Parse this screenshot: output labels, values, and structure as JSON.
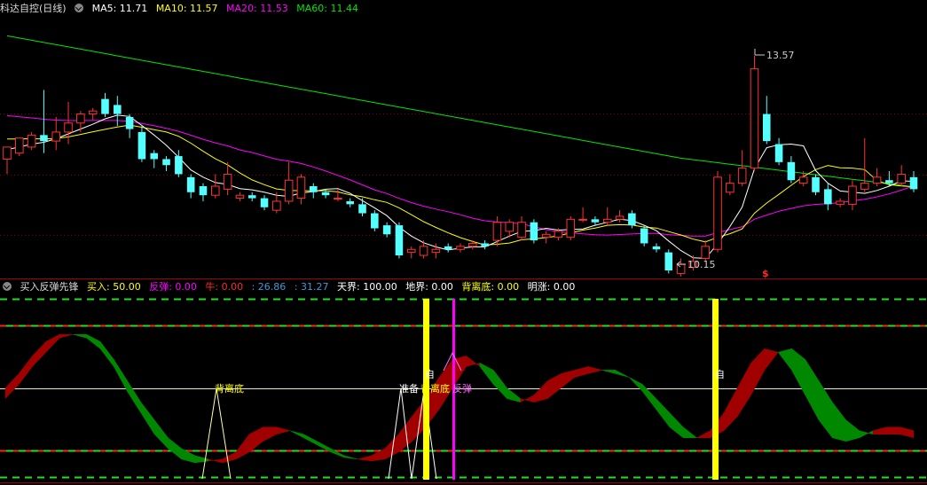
{
  "colors": {
    "up": "#ff3232",
    "down": "#54ffff",
    "ma5": "#ffffff",
    "ma10": "#ffff00",
    "ma20": "#ff00ff",
    "ma60": "#00e600",
    "bull": "#a00000",
    "bear": "#008800",
    "grid": "#800000"
  },
  "top_panel": {
    "title": "科达自控(日线)",
    "ma5": {
      "label": "MA5: 11.71"
    },
    "ma10": {
      "label": "MA10: 11.57"
    },
    "ma20": {
      "label": "MA20: 11.53"
    },
    "ma60": {
      "label": "MA60: 11.44"
    },
    "high_label": "13.57",
    "low_label": "10.15",
    "marker": "$"
  },
  "bottom_panel": {
    "title": "买入反弹先锋",
    "buy": "买入: 50.00",
    "rebound": "反弹: 0.00",
    "bull": "牛: 0.00",
    "v1": ": 26.86",
    "v2": ": 31.27",
    "sky": "天界: 100.00",
    "ground": "地界: 0.00",
    "diverge": "背离底: 0.00",
    "rise": "明涨: 0.00",
    "ann_diverge_1": "背离底",
    "ann_prep": "准备",
    "ann_diverge_2": "背离底",
    "ann_rebound": "反弹",
    "ann_self_1": "自",
    "ann_self_2": "自"
  },
  "chart_data": [
    {
      "type": "candlestick",
      "title": "科达自控(日线)",
      "ylim": [
        10.0,
        14.2
      ],
      "series": [
        {
          "name": "MA5",
          "values": []
        },
        {
          "name": "MA10",
          "values": []
        },
        {
          "name": "MA20",
          "values": []
        },
        {
          "name": "MA60",
          "values": []
        }
      ],
      "candles": [
        [
          11.85,
          12.05,
          11.95,
          11.6
        ],
        [
          11.95,
          12.2,
          12.2,
          11.9
        ],
        [
          12.05,
          12.25,
          12.3,
          12.0
        ],
        [
          12.25,
          12.15,
          13.0,
          11.95
        ],
        [
          12.15,
          12.3,
          12.55,
          12.0
        ],
        [
          12.3,
          12.45,
          12.8,
          12.1
        ],
        [
          12.45,
          12.6,
          12.65,
          12.3
        ],
        [
          12.6,
          12.65,
          12.7,
          12.5
        ],
        [
          12.85,
          12.6,
          12.95,
          12.55
        ],
        [
          12.75,
          12.6,
          12.9,
          12.4
        ],
        [
          12.55,
          12.35,
          12.6,
          12.2
        ],
        [
          12.3,
          11.85,
          12.4,
          11.8
        ],
        [
          11.95,
          11.85,
          12.0,
          11.7
        ],
        [
          11.85,
          11.75,
          11.9,
          11.65
        ],
        [
          11.9,
          11.6,
          12.0,
          11.55
        ],
        [
          11.55,
          11.3,
          11.6,
          11.2
        ],
        [
          11.4,
          11.25,
          11.45,
          11.15
        ],
        [
          11.25,
          11.4,
          11.6,
          11.2
        ],
        [
          11.35,
          11.6,
          11.8,
          11.25
        ],
        [
          11.2,
          11.25,
          11.3,
          11.15
        ],
        [
          11.25,
          11.2,
          11.3,
          11.15
        ],
        [
          11.2,
          11.05,
          11.25,
          11.0
        ],
        [
          11.0,
          11.15,
          11.3,
          10.95
        ],
        [
          11.15,
          11.5,
          11.8,
          11.1
        ],
        [
          11.2,
          11.55,
          11.6,
          11.1
        ],
        [
          11.4,
          11.3,
          11.45,
          11.2
        ],
        [
          11.3,
          11.25,
          11.35,
          11.2
        ],
        [
          11.2,
          11.2,
          11.35,
          11.15
        ],
        [
          11.15,
          11.1,
          11.2,
          11.05
        ],
        [
          11.1,
          10.95,
          11.2,
          10.9
        ],
        [
          10.95,
          10.7,
          11.0,
          10.65
        ],
        [
          10.75,
          10.6,
          10.8,
          10.55
        ],
        [
          10.75,
          10.25,
          10.8,
          10.2
        ],
        [
          10.3,
          10.35,
          10.4,
          10.2
        ],
        [
          10.25,
          10.4,
          10.5,
          10.2
        ],
        [
          10.3,
          10.35,
          10.45,
          10.2
        ],
        [
          10.4,
          10.35,
          10.45,
          10.3
        ],
        [
          10.35,
          10.4,
          10.45,
          10.3
        ],
        [
          10.4,
          10.45,
          10.5,
          10.35
        ],
        [
          10.45,
          10.4,
          10.5,
          10.35
        ],
        [
          10.5,
          10.8,
          10.9,
          10.4
        ],
        [
          10.65,
          10.8,
          10.85,
          10.55
        ],
        [
          10.55,
          10.8,
          10.9,
          10.5
        ],
        [
          10.8,
          10.5,
          10.85,
          10.45
        ],
        [
          10.55,
          10.6,
          10.65,
          10.45
        ],
        [
          10.55,
          10.65,
          10.7,
          10.5
        ],
        [
          10.55,
          10.85,
          10.9,
          10.5
        ],
        [
          10.85,
          10.85,
          11.05,
          10.8
        ],
        [
          10.85,
          10.8,
          10.9,
          10.75
        ],
        [
          10.8,
          10.85,
          11.05,
          10.75
        ],
        [
          10.85,
          10.9,
          11.0,
          10.8
        ],
        [
          10.95,
          10.75,
          11.0,
          10.7
        ],
        [
          10.7,
          10.45,
          10.75,
          10.4
        ],
        [
          10.4,
          10.35,
          10.45,
          10.3
        ],
        [
          10.3,
          10.0,
          10.35,
          9.95
        ],
        [
          9.95,
          10.1,
          10.2,
          9.9
        ],
        [
          10.05,
          10.15,
          10.25,
          10.0
        ],
        [
          10.2,
          10.4,
          10.5,
          10.15
        ],
        [
          10.35,
          11.55,
          11.65,
          10.3
        ],
        [
          11.3,
          11.45,
          11.6,
          11.25
        ],
        [
          11.45,
          11.7,
          12.0,
          11.4
        ],
        [
          11.7,
          13.35,
          13.57,
          11.65
        ],
        [
          12.6,
          12.15,
          12.9,
          12.1
        ],
        [
          12.1,
          11.8,
          12.2,
          11.75
        ],
        [
          11.8,
          11.5,
          11.9,
          11.45
        ],
        [
          11.45,
          11.55,
          11.65,
          11.4
        ],
        [
          11.55,
          11.3,
          11.6,
          11.25
        ],
        [
          11.35,
          11.1,
          11.45,
          11.0
        ],
        [
          11.1,
          11.15,
          11.2,
          11.05
        ],
        [
          11.1,
          11.4,
          11.5,
          11.0
        ],
        [
          11.35,
          11.45,
          12.2,
          11.3
        ],
        [
          11.45,
          11.55,
          11.7,
          11.4
        ],
        [
          11.5,
          11.45,
          11.65,
          11.4
        ],
        [
          11.45,
          11.6,
          11.75,
          11.4
        ],
        [
          11.55,
          11.35,
          11.65,
          11.3
        ]
      ],
      "high": 13.57,
      "low": 10.15
    },
    {
      "type": "area",
      "title": "买入反弹先锋",
      "ylim": [
        0,
        100
      ],
      "levels": [
        0,
        15,
        50,
        85,
        100
      ],
      "series": [
        {
          "name": "买入",
          "values": [
            50,
            58,
            68,
            76,
            80,
            80,
            78,
            72,
            62,
            48,
            36,
            24,
            16,
            10,
            8,
            9,
            10,
            14,
            24,
            28,
            28,
            26,
            22,
            18,
            14,
            11,
            10,
            12,
            16,
            24,
            34,
            44,
            56,
            66,
            68,
            62,
            52,
            44,
            42,
            46,
            54,
            58,
            60,
            62,
            60,
            58,
            56,
            48,
            38,
            28,
            22,
            22,
            26,
            36,
            50,
            64,
            72,
            70,
            60,
            46,
            32,
            22,
            20,
            22,
            26,
            28,
            28,
            26
          ]
        },
        {
          "name": "反弹",
          "values": [
            44,
            52,
            62,
            70,
            78,
            80,
            80,
            76,
            66,
            54,
            42,
            32,
            22,
            16,
            12,
            10,
            8,
            10,
            14,
            20,
            24,
            26,
            24,
            20,
            16,
            12,
            10,
            9,
            10,
            14,
            20,
            28,
            38,
            50,
            62,
            64,
            60,
            50,
            44,
            42,
            44,
            50,
            56,
            58,
            60,
            60,
            56,
            52,
            44,
            36,
            28,
            22,
            22,
            26,
            34,
            46,
            60,
            70,
            72,
            66,
            54,
            42,
            32,
            26,
            24,
            24,
            24,
            22
          ]
        }
      ],
      "labels": [
        "背离底",
        "准备",
        "背离底",
        "反弹",
        "自",
        "自"
      ]
    }
  ]
}
